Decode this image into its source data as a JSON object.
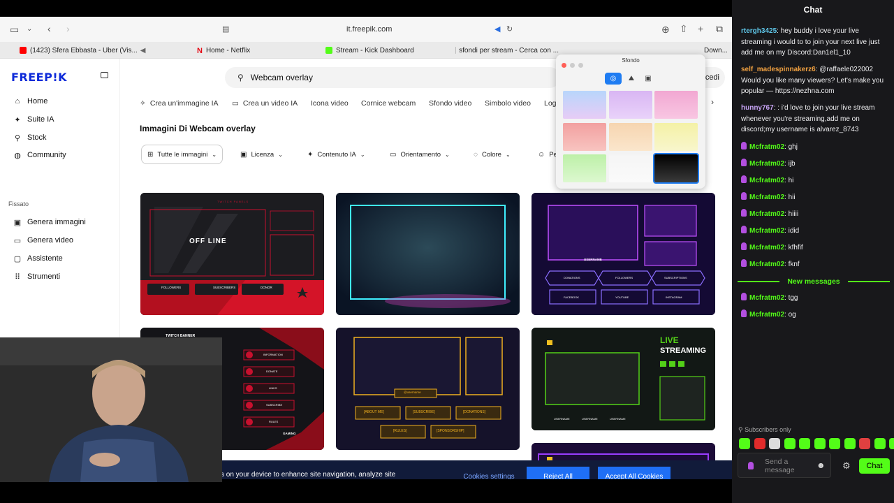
{
  "browser": {
    "url": "it.freepik.com",
    "tabs": [
      {
        "label": "(1423) Sfera Ebbasta - Uber (Vis...",
        "color": "#ff0000"
      },
      {
        "label": "Home - Netflix",
        "color": "#e50914"
      },
      {
        "label": "Stream - Kick Dashboard",
        "color": "#53fc18"
      },
      {
        "label": "sfondi per stream - Cerca con ...",
        "color": "#888888"
      },
      {
        "label": "Down...",
        "color": "#888888"
      }
    ]
  },
  "site": {
    "logo": "FREEP!K",
    "nav": [
      {
        "label": "Home",
        "icon": "home-icon"
      },
      {
        "label": "Suite IA",
        "icon": "sparkle-icon"
      },
      {
        "label": "Stock",
        "icon": "search-icon"
      },
      {
        "label": "Community",
        "icon": "globe-icon"
      }
    ],
    "pinned_label": "Fissato",
    "pinned": [
      {
        "label": "Genera immagini",
        "icon": "image-icon"
      },
      {
        "label": "Genera video",
        "icon": "video-icon"
      },
      {
        "label": "Assistente",
        "icon": "chat-icon"
      },
      {
        "label": "Strumenti",
        "icon": "grid-icon"
      }
    ],
    "search_value": "Webcam overlay",
    "login_label": "cedi",
    "categories": [
      "Crea un'immagine IA",
      "Crea un video IA",
      "Icona video",
      "Cornice webcam",
      "Sfondo video",
      "Simbolo video",
      "Log"
    ],
    "heading": "Immagini Di Webcam overlay",
    "filters": [
      "Tutte le immagini",
      "Licenza",
      "Contenuto IA",
      "Orientamento",
      "Colore",
      "Pe"
    ],
    "cards": {
      "c1_offline": "OFF LINE",
      "c1_top": "TWITCH PANELS",
      "c1_buttons": [
        "FOLLOWERS",
        "SUBSCRIBERS",
        "DONOR"
      ],
      "c3_username": "USERNAME",
      "c3_row1": [
        "DONATIONS",
        "FOLLOWERS",
        "SUBSCRIPTIONS"
      ],
      "c3_row2": [
        "FACEBOOK",
        "YOUTUBE",
        "INSTAGRAM"
      ],
      "c4_title": "TWITCH BANNER",
      "c4_sub": "COLLECTION",
      "c4_items": [
        "INFORMATION",
        "DONATE",
        "LINKS",
        "SUBSCRIBE",
        "RULES"
      ],
      "c4_gaming": "GAMING",
      "c5_username": "@username",
      "c5_row1": [
        "[ABOUT ME]",
        "[SUBSCRIBE]",
        "[DONATIONS]"
      ],
      "c5_row2": [
        "[RULES]",
        "[SPONSORSHIP]"
      ],
      "c6_live": "LIVE",
      "c6_streaming": "STREAMING",
      "c6_social": [
        "USERNAME",
        "USERNAME",
        "USERNAME"
      ]
    }
  },
  "popup": {
    "title": "Sfondo",
    "swatches": [
      [
        "#b8d6fb",
        "#e7ccf6"
      ],
      [
        "#d9b6f3",
        "#e9d2fa"
      ],
      [
        "#f2a8d2",
        "#f8c6e2"
      ],
      [
        "#f2a0a0",
        "#f8c4c0"
      ],
      [
        "#f6d5b0",
        "#fbe6cc"
      ],
      [
        "#f4f1a6",
        "#f8f6cc"
      ],
      [
        "#bdf0a8",
        "#dcf8cf"
      ],
      [
        "#f5f5f5",
        "#fafafa"
      ],
      [
        "#000000",
        "#3a3a3a"
      ]
    ]
  },
  "cookie": {
    "text": "s on your device to enhance site navigation, analyze site",
    "settings": "Cookies settings",
    "reject": "Reject All",
    "accept": "Accept All Cookies"
  },
  "chat": {
    "title": "Chat",
    "messages": [
      {
        "user": "rtergh3425",
        "color": "#5ec6e8",
        "text": "hey buddy i love your live streaming i would to to join your next live just add me on my Discord:Dan1el1_10",
        "badge": false
      },
      {
        "user": "self_madespinnakerz6",
        "color": "#f0a040",
        "text": "@raffaele022002 Would you like many viewers? Let's make you popular — https://nezhna.com",
        "badge": false
      },
      {
        "user": "hunny767",
        "color": "#c7a4f5",
        "text": ": i'd love to join your live stream whenever you're streaming,add me on discord;my username is alvarez_8743",
        "badge": false
      },
      {
        "user": "Mcfratm02",
        "color": "#53fc18",
        "text": "ghj",
        "badge": true
      },
      {
        "user": "Mcfratm02",
        "color": "#53fc18",
        "text": "ijb",
        "badge": true
      },
      {
        "user": "Mcfratm02",
        "color": "#53fc18",
        "text": "hi",
        "badge": true
      },
      {
        "user": "Mcfratm02",
        "color": "#53fc18",
        "text": "hii",
        "badge": true
      },
      {
        "user": "Mcfratm02",
        "color": "#53fc18",
        "text": "hiiii",
        "badge": true
      },
      {
        "user": "Mcfratm02",
        "color": "#53fc18",
        "text": "idid",
        "badge": true
      },
      {
        "user": "Mcfratm02",
        "color": "#53fc18",
        "text": "kfhfif",
        "badge": true
      },
      {
        "user": "Mcfratm02",
        "color": "#53fc18",
        "text": "fknf",
        "badge": true
      }
    ],
    "new_messages_label": "New messages",
    "new_messages": [
      {
        "user": "Mcfratm02",
        "color": "#53fc18",
        "text": "tgg",
        "badge": true
      },
      {
        "user": "Mcfratm02",
        "color": "#53fc18",
        "text": "og",
        "badge": true
      }
    ],
    "subscribers_only": "Subscribers only",
    "send_placeholder": "Send a message",
    "chat_button": "Chat",
    "accent": "#53fc18"
  }
}
